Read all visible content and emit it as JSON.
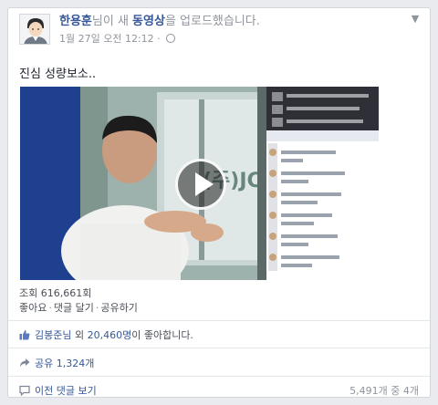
{
  "post": {
    "author": "한용훈",
    "headline_mid": "님이 새 ",
    "headline_link": "동영상",
    "headline_end": "을 업로드했습니다.",
    "timestamp": "1월 27일 오전 12:12 · ",
    "status_text": "진심 성량보소.."
  },
  "video": {
    "views": "조회 616,661회",
    "actions": [
      "좋아요",
      "댓글 달기",
      "공유하기"
    ],
    "action_separator": "·"
  },
  "reactions": {
    "liker": "김봉준님",
    "liker_mid": " 외 ",
    "liker_count": "20,460명",
    "liker_end": "이 좋아합니다."
  },
  "shares": {
    "label": "공유 1,324개"
  },
  "comments": {
    "prev_label": "이전 댓글 보기",
    "count": "5,491개 중 4개"
  },
  "colors": {
    "link": "#365899",
    "meta": "#90949c",
    "text": "#1d2129",
    "border": "#d3d6db"
  },
  "icons": [
    "chevron-down-icon",
    "globe-icon",
    "play-icon",
    "thumbs-up-icon",
    "share-icon",
    "comment-icon"
  ]
}
